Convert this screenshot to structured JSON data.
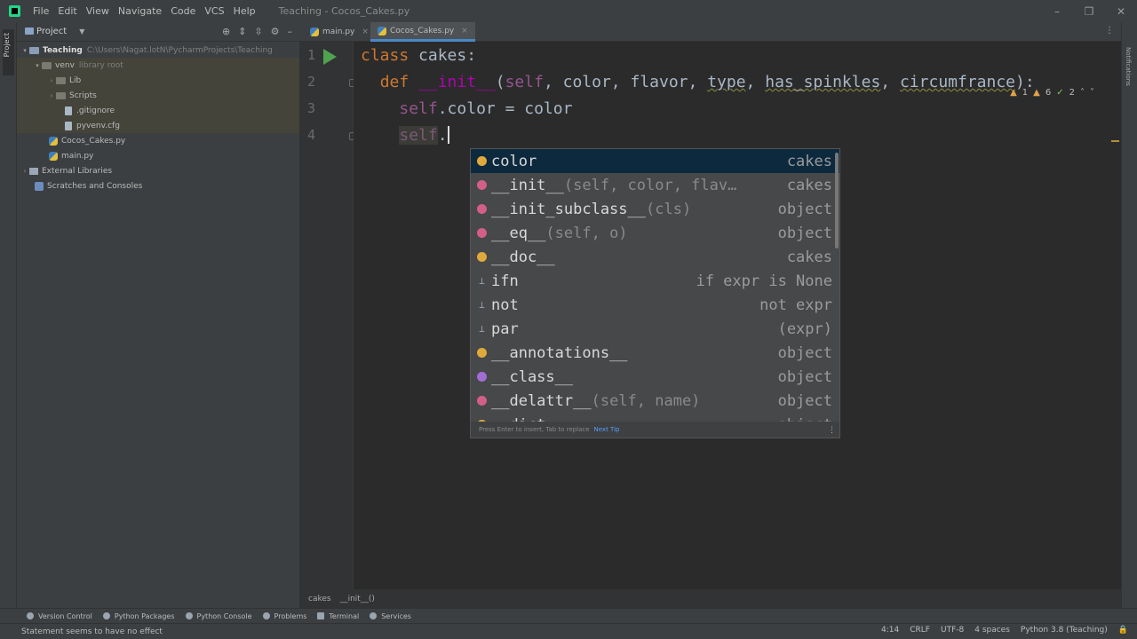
{
  "titlebar": {
    "menus": [
      "File",
      "Edit",
      "View",
      "Navigate",
      "Code",
      "VCS",
      "Help"
    ],
    "window_title": "Teaching - Cocos_Cakes.py",
    "controls": [
      "–",
      "❐",
      "✕"
    ]
  },
  "left_strip": {
    "project_tab": "Project"
  },
  "project_panel": {
    "title": "Project",
    "dropdown": "▼",
    "tools": [
      "⊕",
      "⇕",
      "⇳",
      "⚙",
      "–"
    ],
    "tree": [
      {
        "label": "Teaching",
        "path": "C:\\Users\\Nagat.lotN\\PycharmProjects\\Teaching",
        "arrow": "▾"
      },
      {
        "label": "venv",
        "path": "library root",
        "arrow": "▾"
      },
      {
        "label": "Lib",
        "arrow": "›"
      },
      {
        "label": "Scripts",
        "arrow": "›"
      },
      {
        "label": ".gitignore"
      },
      {
        "label": "pyvenv.cfg"
      },
      {
        "label": "Cocos_Cakes.py"
      },
      {
        "label": "main.py"
      },
      {
        "label": "External Libraries",
        "arrow": "›"
      },
      {
        "label": "Scratches and Consoles"
      }
    ]
  },
  "editor": {
    "tabs": [
      {
        "label": "main.py",
        "close": "×"
      },
      {
        "label": "Cocos_Cakes.py",
        "close": "×"
      }
    ],
    "tabs_menu": "⋮",
    "inspection": {
      "warnings": "1",
      "weak_warnings": "6",
      "typos": "2",
      "up": "˄",
      "down": "˅"
    },
    "line_numbers": [
      "1",
      "2",
      "3",
      "4"
    ],
    "code": {
      "l1_kw": "class",
      "l1_name": "cakes",
      "l1_colon": ":",
      "l2_kw": "def",
      "l2_fn": "__init__",
      "l2_open": "(",
      "l2_self": "self",
      "l2_p1": ", color, flavor, ",
      "l2_type": "type",
      "l2_sep1": ", ",
      "l2_sprinkles": "has_spinkles",
      "l2_sep2": ", ",
      "l2_circ": "circumfrance",
      "l2_close": "):",
      "l3_self": "self",
      "l3_rest": ".color = color",
      "l4_self": "self",
      "l4_dot": "."
    }
  },
  "completion": {
    "items": [
      {
        "icon": "field",
        "name": "color",
        "sig": "",
        "type": "cakes"
      },
      {
        "icon": "method",
        "name": "__init__",
        "sig": "(self, color, flav…",
        "type": "cakes"
      },
      {
        "icon": "method",
        "name": "__init_subclass__",
        "sig": "(cls)",
        "type": "object"
      },
      {
        "icon": "method",
        "name": "__eq__",
        "sig": "(self, o)",
        "type": "object"
      },
      {
        "icon": "field",
        "name": "__doc__",
        "sig": "",
        "type": "cakes"
      },
      {
        "icon": "template",
        "name": "ifn",
        "sig": "",
        "type": "if expr is None"
      },
      {
        "icon": "template",
        "name": "not",
        "sig": "",
        "type": "not expr"
      },
      {
        "icon": "template",
        "name": "par",
        "sig": "",
        "type": "(expr)"
      },
      {
        "icon": "field",
        "name": "__annotations__",
        "sig": "",
        "type": "object"
      },
      {
        "icon": "class",
        "name": "__class__",
        "sig": "",
        "type": "object"
      },
      {
        "icon": "method",
        "name": "__delattr__",
        "sig": "(self, name)",
        "type": "object"
      },
      {
        "icon": "field",
        "name": "__dict__",
        "sig": "",
        "type": "object"
      }
    ],
    "template_glyph": "⊥",
    "footer_text": "Press Enter to insert, Tab to replace",
    "footer_link": "Next Tip",
    "menu": "⋮"
  },
  "breadcrumb": [
    "cakes",
    "__init__()"
  ],
  "tool_windows": [
    "Version Control",
    "Python Packages",
    "Python Console",
    "Problems",
    "Terminal",
    "Services"
  ],
  "status": {
    "message": "Statement seems to have no effect",
    "position": "4:14",
    "line_sep": "CRLF",
    "encoding": "UTF-8",
    "indent": "4 spaces",
    "interpreter": "Python 3.8 (Teaching)",
    "lock": "🔒"
  },
  "right_strip": {
    "label": "Notifications"
  }
}
